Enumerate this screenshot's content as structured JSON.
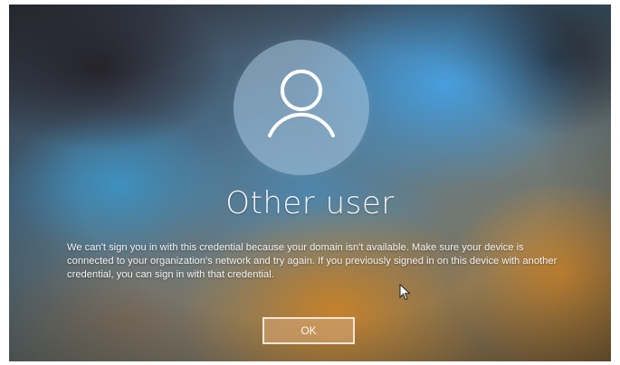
{
  "login_screen": {
    "username": "Other user",
    "message": "We can't sign you in with this credential because your domain isn't available. Make sure your device is connected to your organization's network and try again. If you previously signed in on this device with another credential, you can sign in with that credential.",
    "ok_label": "OK"
  },
  "icons": {
    "avatar": "user-silhouette-icon",
    "cursor": "mouse-pointer-icon"
  },
  "colors": {
    "text": "#f4f4f4",
    "button_border": "#f0e6d8",
    "avatar_fill": "#aac8e1"
  }
}
